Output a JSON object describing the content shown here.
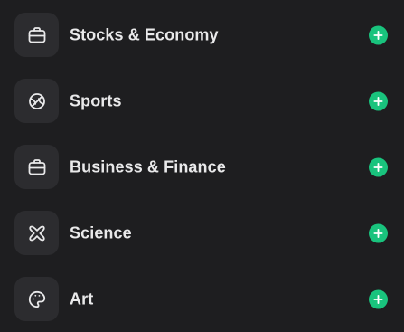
{
  "topics": [
    {
      "label": "Stocks & Economy",
      "icon": "briefcase-icon"
    },
    {
      "label": "Sports",
      "icon": "sports-ball-icon"
    },
    {
      "label": "Business & Finance",
      "icon": "briefcase-icon"
    },
    {
      "label": "Science",
      "icon": "atom-icon"
    },
    {
      "label": "Art",
      "icon": "palette-icon"
    }
  ],
  "colors": {
    "background": "#1e1e20",
    "tile": "#2c2c2f",
    "text": "#e9e9ea",
    "accent": "#19c37d"
  }
}
